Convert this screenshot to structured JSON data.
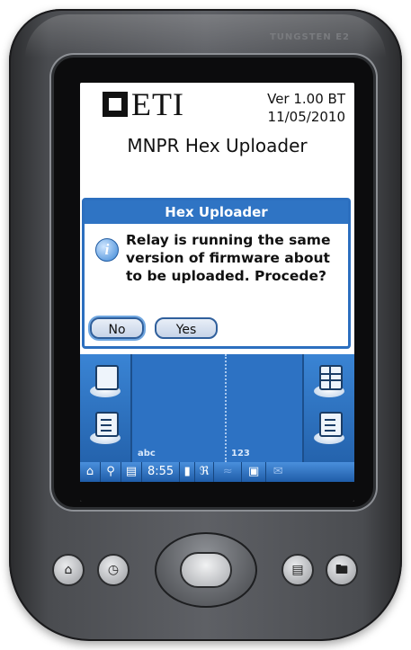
{
  "device": {
    "brand": "TUNGSTEN E2"
  },
  "app": {
    "logo_text": "ETI",
    "version": "Ver 1.00 BT",
    "date": "11/05/2010",
    "title": "MNPR Hex Uploader"
  },
  "dialog": {
    "title": "Hex Uploader",
    "message": "Relay is running the same version of firmware about to be uploaded. Procede?",
    "no_label": "No",
    "yes_label": "Yes"
  },
  "launcher": {
    "graffiti_left_label": "abc",
    "graffiti_right_label": "123",
    "icons": [
      "contacts-icon",
      "memo-icon",
      "calculator-icon",
      "tasks-icon"
    ]
  },
  "statusbar": {
    "time": "8:55",
    "icons": [
      "home-icon",
      "search-icon",
      "menu-icon",
      "bluetooth-icon",
      "signal-icon",
      "display-icon",
      "mail-icon"
    ]
  },
  "colors": {
    "dialog_title_bg": "#2f74c4",
    "launcher_bg": "#2a6fc0",
    "statusbar_bg": "#1f5da8"
  }
}
